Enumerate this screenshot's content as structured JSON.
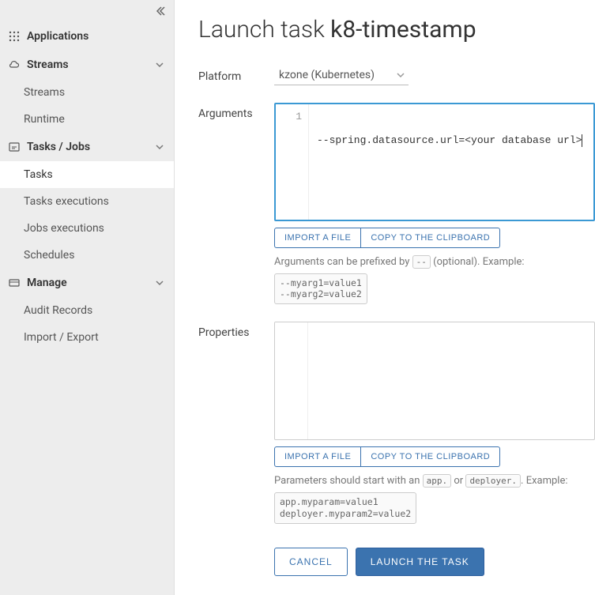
{
  "sidebar": {
    "applications": {
      "label": "Applications"
    },
    "streams": {
      "label": "Streams",
      "items": [
        {
          "label": "Streams"
        },
        {
          "label": "Runtime"
        }
      ]
    },
    "tasks": {
      "label": "Tasks / Jobs",
      "items": [
        {
          "label": "Tasks",
          "active": true
        },
        {
          "label": "Tasks executions"
        },
        {
          "label": "Jobs executions"
        },
        {
          "label": "Schedules"
        }
      ]
    },
    "manage": {
      "label": "Manage",
      "items": [
        {
          "label": "Audit Records"
        },
        {
          "label": "Import / Export"
        }
      ]
    }
  },
  "page": {
    "title_prefix": "Launch task ",
    "task_name": "k8-timestamp"
  },
  "form": {
    "platform": {
      "label": "Platform",
      "value": "kzone (Kubernetes)"
    },
    "arguments": {
      "label": "Arguments",
      "line_number": "1",
      "content": "--spring.datasource.url=<your database url>",
      "import_label": "IMPORT A FILE",
      "copy_label": "COPY TO THE CLIPBOARD",
      "help_prefix": "Arguments can be prefixed by ",
      "help_code": "--",
      "help_suffix": " (optional). Example:",
      "example": "--myarg1=value1\n--myarg2=value2"
    },
    "properties": {
      "label": "Properties",
      "import_label": "IMPORT A FILE",
      "copy_label": "COPY TO THE CLIPBOARD",
      "help_prefix": "Parameters should start with an ",
      "help_code1": "app.",
      "help_mid": " or ",
      "help_code2": "deployer.",
      "help_suffix": ". Example:",
      "example": "app.myparam=value1\ndeployer.myparam2=value2"
    }
  },
  "actions": {
    "cancel": "CANCEL",
    "launch": "LAUNCH THE TASK"
  }
}
